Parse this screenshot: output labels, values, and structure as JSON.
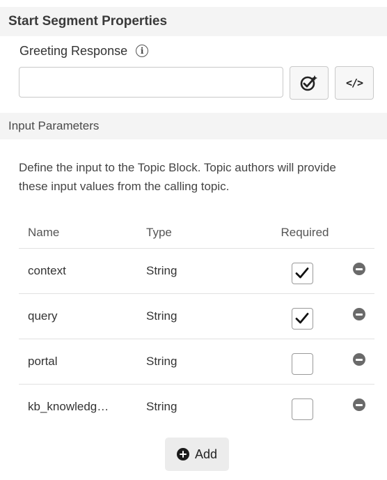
{
  "start_segment": {
    "title": "Start Segment Properties",
    "greeting_label": "Greeting Response",
    "greeting_info_icon": "info-icon",
    "greeting_value": "",
    "greeting_placeholder": "",
    "ai_button_icon": "ai-assist-icon",
    "code_button_icon": "code-icon",
    "code_glyph": "</>"
  },
  "input_parameters": {
    "title": "Input Parameters",
    "description": "Define the input to the Topic Block. Topic authors will provide these input values from the calling topic.",
    "columns": [
      "Name",
      "Type",
      "Required"
    ],
    "rows": [
      {
        "name": "context",
        "type": "String",
        "required": true
      },
      {
        "name": "query",
        "type": "String",
        "required": true
      },
      {
        "name": "portal",
        "type": "String",
        "required": false
      },
      {
        "name": "kb_knowledge_base",
        "name_display": "kb_knowledg…",
        "type": "String",
        "required": false
      }
    ],
    "remove_icon": "minus-circle-icon",
    "add_label": "Add",
    "add_icon": "plus-circle-icon"
  }
}
